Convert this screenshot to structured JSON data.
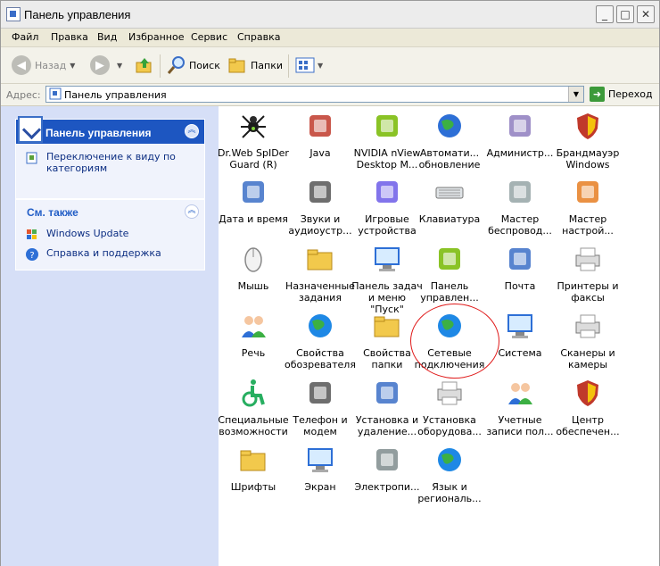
{
  "window": {
    "title": "Панель управления",
    "buttons": {
      "minimize": "_",
      "maximize": "□",
      "close": "✕"
    }
  },
  "menu": [
    "Файл",
    "Правка",
    "Вид",
    "Избранное",
    "Сервис",
    "Справка"
  ],
  "toolbar": {
    "back_label": "Назад",
    "search_label": "Поиск",
    "folders_label": "Папки"
  },
  "address": {
    "label": "Адрес:",
    "value": "Панель управления",
    "go_label": "Переход"
  },
  "sidebar": {
    "panel1": {
      "title": "Панель управления",
      "link": "Переключение к виду по категориям"
    },
    "panel2": {
      "title": "См. также",
      "links": [
        "Windows Update",
        "Справка и поддержка"
      ]
    }
  },
  "items": [
    {
      "label": "Dr.Web SpIDer Guard (R)",
      "icon": "spider-icon"
    },
    {
      "label": "Java",
      "icon": "java-cup-icon"
    },
    {
      "label": "NVIDIA nView Desktop M...",
      "icon": "nvidia-icon"
    },
    {
      "label": "Автомати... обновление",
      "icon": "windows-update-icon"
    },
    {
      "label": "Администр...",
      "icon": "admin-tools-icon"
    },
    {
      "label": "Брандмауэр Windows",
      "icon": "firewall-icon"
    },
    {
      "label": "Дата и время",
      "icon": "calendar-clock-icon"
    },
    {
      "label": "Звуки и аудиоустр...",
      "icon": "speaker-icon"
    },
    {
      "label": "Игровые устройства",
      "icon": "gamepad-icon"
    },
    {
      "label": "Клавиатура",
      "icon": "keyboard-icon"
    },
    {
      "label": "Мастер беспровод...",
      "icon": "wireless-wizard-icon"
    },
    {
      "label": "Мастер настрой...",
      "icon": "network-wizard-icon"
    },
    {
      "label": "Мышь",
      "icon": "mouse-icon"
    },
    {
      "label": "Назначенные задания",
      "icon": "scheduled-tasks-icon"
    },
    {
      "label": "Панель задач и меню \"Пуск\"",
      "icon": "taskbar-icon"
    },
    {
      "label": "Панель управлен...",
      "icon": "nvidia-panel-icon"
    },
    {
      "label": "Почта",
      "icon": "mail-icon"
    },
    {
      "label": "Принтеры и факсы",
      "icon": "printer-icon"
    },
    {
      "label": "Речь",
      "icon": "speech-icon"
    },
    {
      "label": "Свойства обозревателя",
      "icon": "internet-options-icon"
    },
    {
      "label": "Свойства папки",
      "icon": "folder-options-icon"
    },
    {
      "label": "Сетевые подключения",
      "icon": "network-connections-icon"
    },
    {
      "label": "Система",
      "icon": "system-icon"
    },
    {
      "label": "Сканеры и камеры",
      "icon": "scanner-camera-icon"
    },
    {
      "label": "Специальные возможности",
      "icon": "accessibility-icon"
    },
    {
      "label": "Телефон и модем",
      "icon": "phone-modem-icon"
    },
    {
      "label": "Установка и удаление...",
      "icon": "add-remove-programs-icon"
    },
    {
      "label": "Установка оборудова...",
      "icon": "add-hardware-icon"
    },
    {
      "label": "Учетные записи пол...",
      "icon": "user-accounts-icon"
    },
    {
      "label": "Центр обеспечен...",
      "icon": "security-center-icon"
    },
    {
      "label": "Шрифты",
      "icon": "fonts-folder-icon"
    },
    {
      "label": "Экран",
      "icon": "display-icon"
    },
    {
      "label": "Электропи...",
      "icon": "power-options-icon"
    },
    {
      "label": "Язык и региональ...",
      "icon": "regional-options-icon"
    }
  ],
  "colors": {
    "sidebar_bg": "#d6dff7",
    "panel_header_blue": "#1d56c1",
    "highlight_oval": "#e01b1b"
  }
}
